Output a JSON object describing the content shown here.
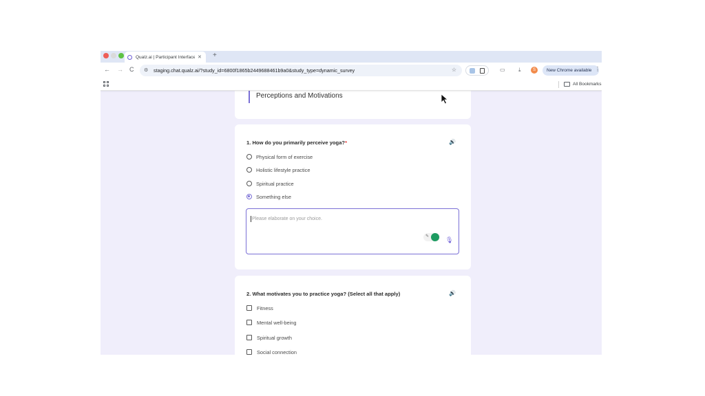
{
  "tab": {
    "title": "Qualz.ai | Participant Interface",
    "close_glyph": "✕",
    "new_tab_glyph": "+"
  },
  "toolbar": {
    "back_glyph": "←",
    "forward_glyph": "→",
    "reload_glyph": "C",
    "url": "staging.chat.qualz.ai/?study_id=6800f1865b2449688461b9a0&study_type=dynamic_survey",
    "star_glyph": "☆",
    "avatar_letter": "S",
    "update_label": "New Chrome available",
    "menu_glyph": "⋮"
  },
  "bookmarks": {
    "all_bookmarks_label": "All Bookmarks"
  },
  "survey": {
    "section_title": "Perceptions and Motivations",
    "q1": {
      "title": "1. How do you primarily perceive yoga?",
      "required_mark": "*",
      "options": [
        "Physical form of exercise",
        "Holistic lifestyle practice",
        "Spiritual practice",
        "Something else"
      ],
      "selected_option": "Something else",
      "elaborate_placeholder": "Please elaborate on your choice."
    },
    "q2": {
      "title": "2. What motivates you to practice yoga? (Select all that apply)",
      "options": [
        "Fitness",
        "Mental well-being",
        "Spiritual growth",
        "Social connection"
      ]
    }
  },
  "icons": {
    "speaker": "speaker-icon",
    "mic": "microphone-icon",
    "grammar": "grammarly-icon"
  },
  "colors": {
    "accent": "#7a6fd6",
    "page_background": "#f0eefb",
    "required": "#e53b3b",
    "avatar": "#f28b4b"
  }
}
